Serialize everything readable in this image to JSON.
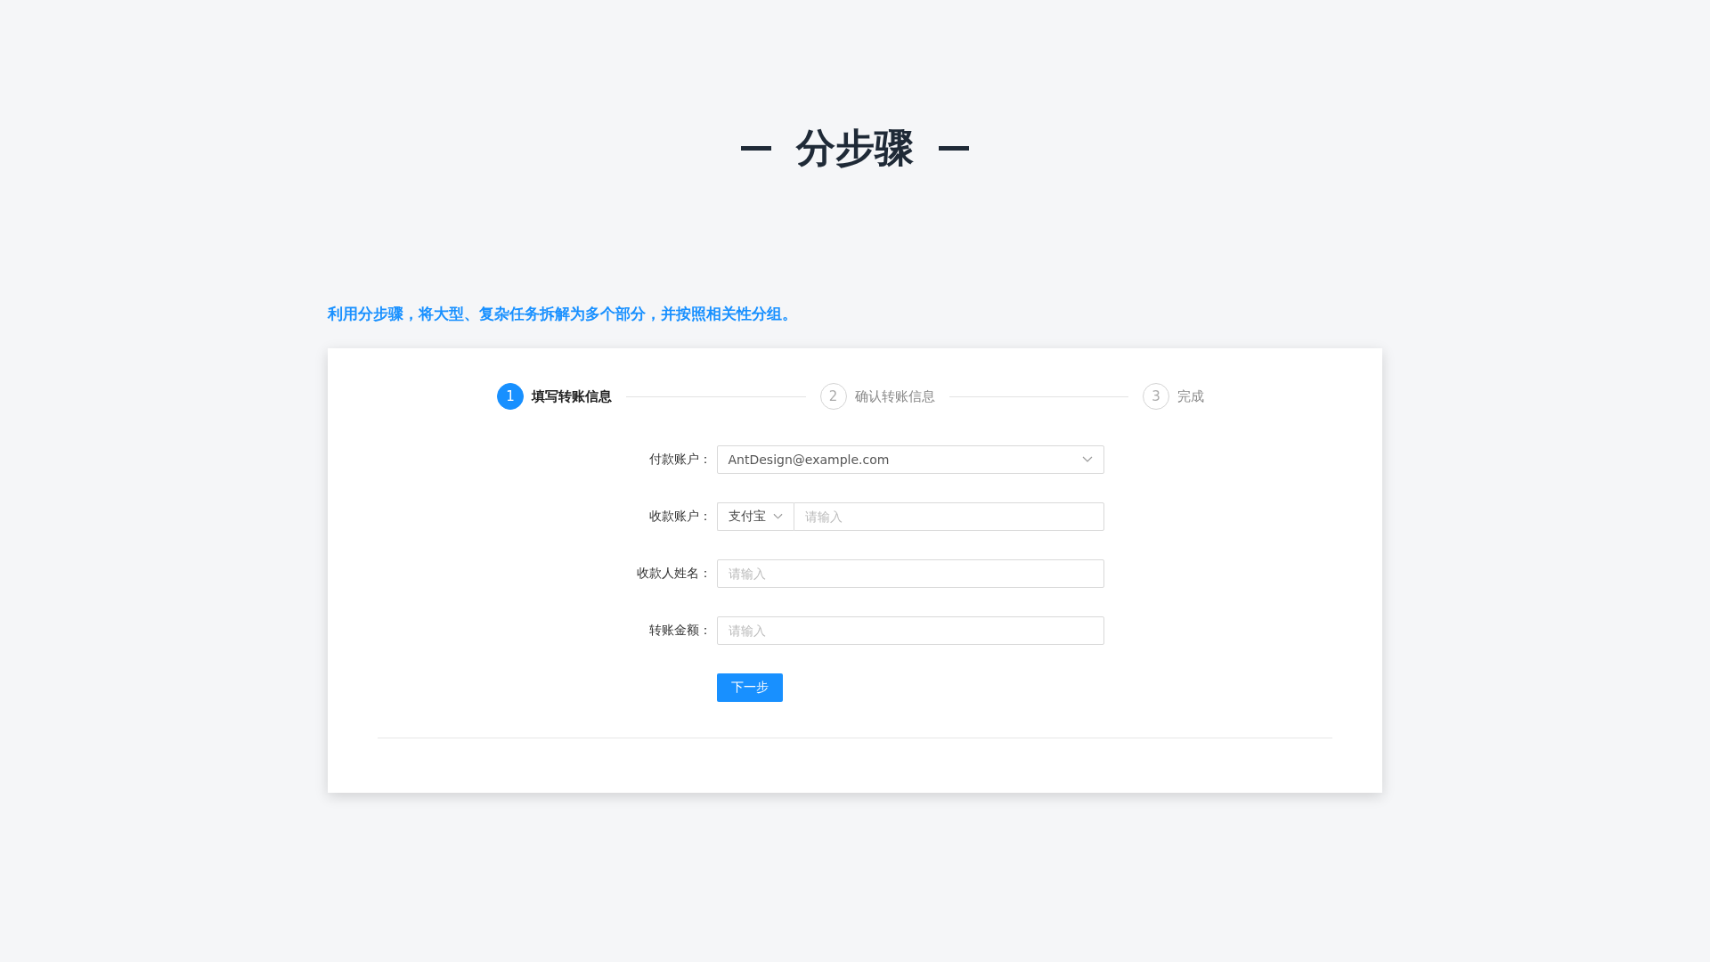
{
  "title": "分步骤",
  "description": "利用分步骤，将大型、复杂任务拆解为多个部分，并按照相关性分组。",
  "steps": [
    {
      "number": "1",
      "label": "填写转账信息",
      "selected": true
    },
    {
      "number": "2",
      "label": "确认转账信息",
      "selected": false
    },
    {
      "number": "3",
      "label": "完成",
      "selected": false
    }
  ],
  "form": [
    {
      "kind": "select",
      "label": "付款账户：",
      "value": "AntDesign@example.com"
    },
    {
      "kind": "addon",
      "label": "收款账户：",
      "addon": "支付宝",
      "placeholder": "请输入"
    },
    {
      "kind": "input",
      "label": "收款人姓名：",
      "placeholder": "请输入"
    },
    {
      "kind": "input",
      "label": "转账金额：",
      "placeholder": "请输入"
    }
  ],
  "button": "下一步"
}
